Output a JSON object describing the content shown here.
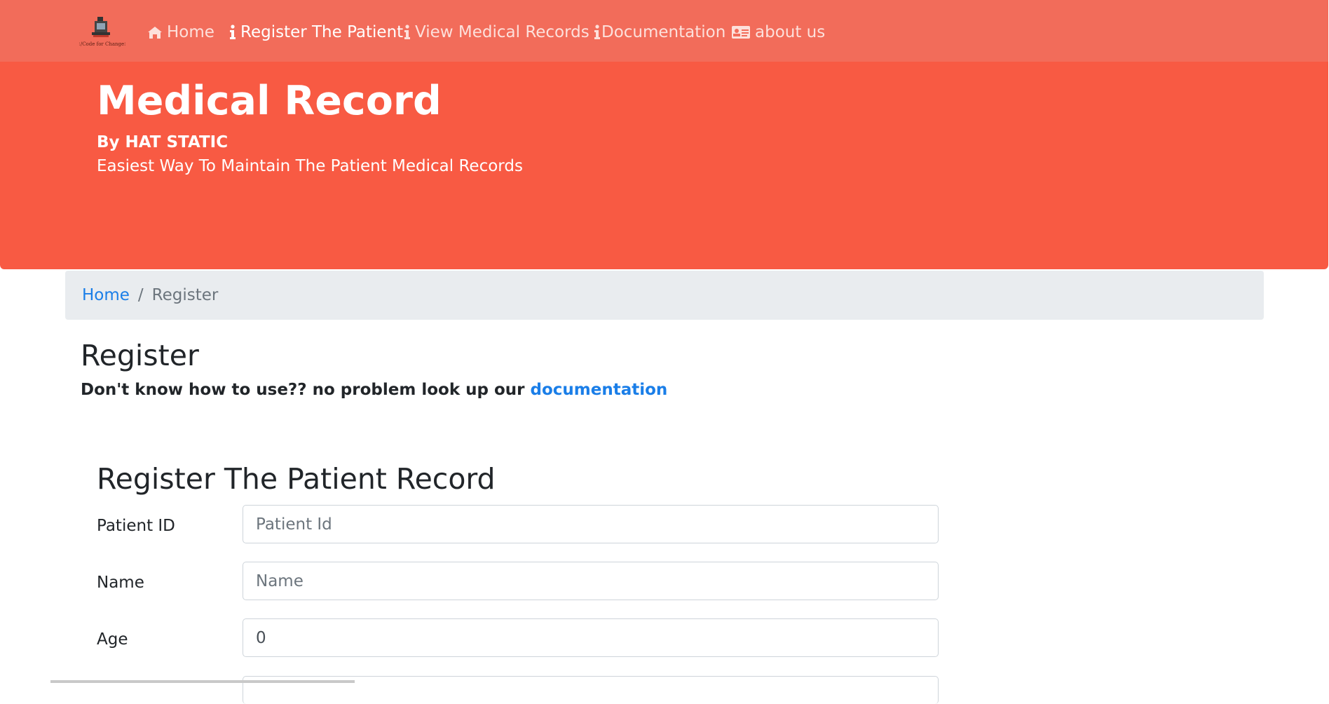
{
  "navbar": {
    "brand_caption": "</Code for Change>",
    "items": [
      {
        "label": "Home",
        "icon": "home-icon"
      },
      {
        "label": "Register The Patient",
        "icon": "info-icon"
      },
      {
        "label": "View Medical Records",
        "icon": "info-icon"
      },
      {
        "label": "Documentation",
        "icon": "info-icon"
      },
      {
        "label": "about us",
        "icon": "id-card-icon"
      }
    ],
    "active_item": "Register The Patient"
  },
  "hero": {
    "title": "Medical Record",
    "byline": "By HAT STATIC",
    "tagline": "Easiest Way To Maintain The Patient Medical Records"
  },
  "breadcrumb": {
    "home": "Home",
    "separator": "/",
    "current": "Register"
  },
  "page": {
    "title": "Register",
    "help_text": "Don't know how to use?? no problem look up our ",
    "help_link": "documentation"
  },
  "form": {
    "title": "Register The Patient Record",
    "fields": [
      {
        "label": "Patient ID",
        "placeholder": "Patient Id",
        "value": ""
      },
      {
        "label": "Name",
        "placeholder": "Name",
        "value": ""
      },
      {
        "label": "Age",
        "placeholder": "",
        "value": "0"
      }
    ]
  },
  "colors": {
    "hero": "#f85a43",
    "navbar": "#f26c5a",
    "link": "#1a7ee8",
    "breadcrumb_bg": "#e9ecef"
  }
}
